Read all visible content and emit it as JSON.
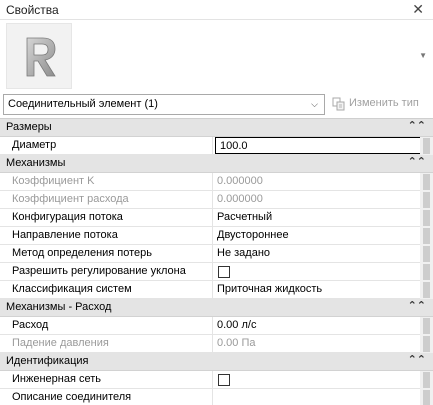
{
  "window": {
    "title": "Свойства",
    "close_glyph": "✕"
  },
  "type_panel": {
    "icon": "revit-family-icon",
    "scroll_glyph": "▼"
  },
  "selector": {
    "family_type": "Соединительный элемент (1)",
    "dropdown_glyph": "⌵",
    "edit_type_label": "Изменить тип",
    "edit_type_icon": "edit-type-icon"
  },
  "collapse_glyph": "⌃⌃",
  "groups": {
    "sizes": {
      "name": "Размеры",
      "props": {
        "diameter": {
          "name": "Диаметр",
          "value": "100.0"
        }
      }
    },
    "mechanics": {
      "name": "Механизмы",
      "props": {
        "k_coefficient": {
          "name": "Коэффициент K",
          "value": "0.000000"
        },
        "flow_coefficient": {
          "name": "Коэффициент расхода",
          "value": "0.000000"
        },
        "flow_configuration": {
          "name": "Конфигурация потока",
          "value": "Расчетный"
        },
        "flow_direction": {
          "name": "Направление потока",
          "value": "Двустороннее"
        },
        "loss_method": {
          "name": "Метод определения потерь",
          "value": "Не задано"
        },
        "allow_slope_adjustment": {
          "name": "Разрешить регулирование уклона",
          "checked": false
        },
        "system_classification": {
          "name": "Классификация систем",
          "value": "Приточная жидкость"
        }
      }
    },
    "mechanics_flow": {
      "name": "Механизмы - Расход",
      "props": {
        "flow": {
          "name": "Расход",
          "value": "0.00 л/с"
        },
        "pressure_drop": {
          "name": "Падение давления",
          "value": "0.00 Па"
        }
      }
    },
    "identification": {
      "name": "Идентификация",
      "props": {
        "engineering_network": {
          "name": "Инженерная сеть",
          "checked": false
        },
        "connector_description": {
          "name": "Описание соединителя",
          "value": ""
        }
      }
    }
  }
}
